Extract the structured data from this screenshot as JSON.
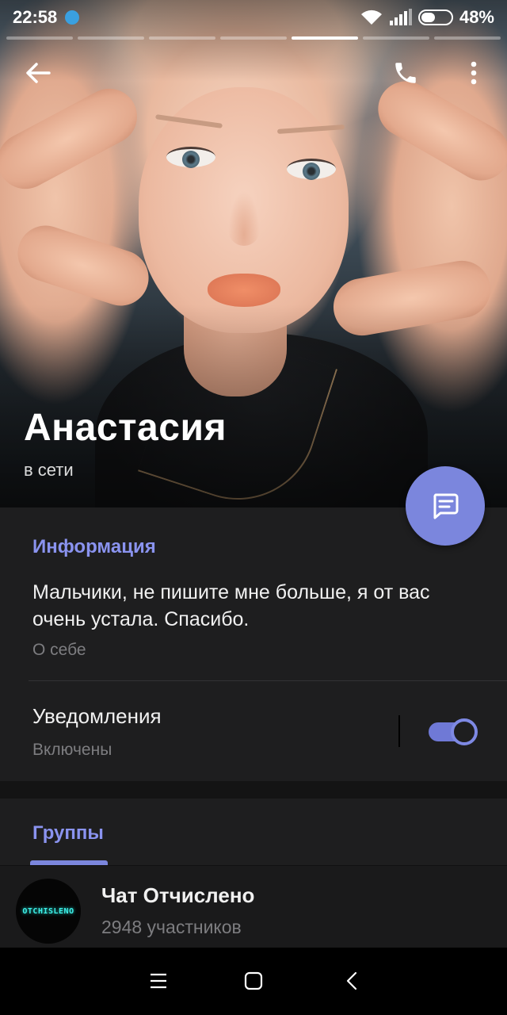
{
  "status_bar": {
    "time": "22:58",
    "battery": "48%",
    "battery_level": 0.48
  },
  "stories": {
    "count": 7,
    "active_index": 4
  },
  "profile": {
    "name": "Анастасия",
    "status": "в сети"
  },
  "info_section": {
    "title": "Информация",
    "bio": "Мальчики, не пишите мне больше, я от вас очень устала. Спасибо.",
    "bio_caption": "О себе",
    "notifications_label": "Уведомления",
    "notifications_state": "Включены",
    "notifications_on": true
  },
  "groups_section": {
    "title": "Группы",
    "items": [
      {
        "name": "Чат Отчислено",
        "members": "2948 участников",
        "avatar_text": "OTCHISLENO"
      }
    ]
  },
  "colors": {
    "accent": "#7b86dd",
    "section_title": "#8a93ef",
    "background": "#1e1e1f",
    "secondary_text": "#7d7d80"
  },
  "icons": {
    "back": "arrow-left-icon",
    "call": "phone-icon",
    "more": "more-vertical-icon",
    "message": "message-icon",
    "wifi": "wifi-icon",
    "signal": "signal-icon",
    "battery": "battery-icon",
    "telegram": "telegram-icon",
    "nav_menu": "menu-icon",
    "nav_home": "home-square-icon",
    "nav_back": "chevron-left-icon"
  }
}
